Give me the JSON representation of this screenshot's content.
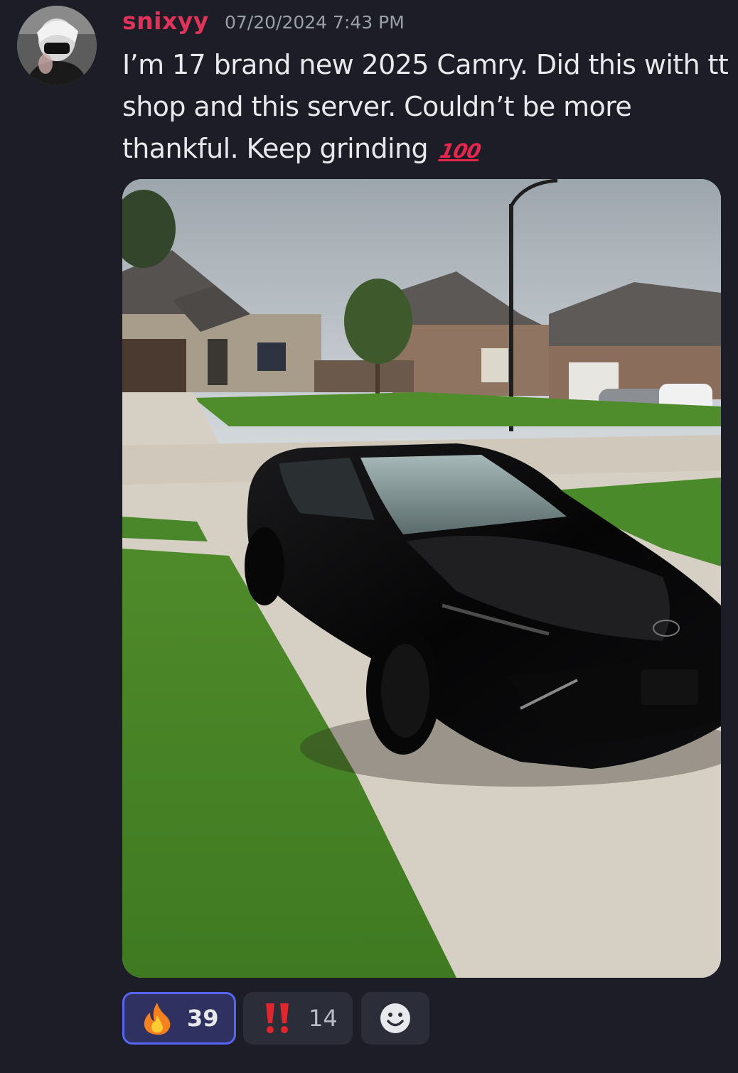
{
  "message": {
    "author": "snixyy",
    "timestamp": "07/20/2024 7:43 PM",
    "text": "I’m 17 brand new 2025 Camry. Did this with tt shop and this server. Couldn’t be more thankful. Keep grinding",
    "trailing_emoji_glyph": "100",
    "trailing_emoji_name": "hundred-points-icon",
    "author_color": "#e0335a"
  },
  "attachment": {
    "description": "photo of a black 2025 Toyota Camry parked on a driveway in front of houses"
  },
  "reactions": [
    {
      "emoji_name": "fire-icon",
      "count": "39",
      "selected": true
    },
    {
      "emoji_name": "double-exclamation-icon",
      "count": "14",
      "selected": false
    }
  ],
  "add_reaction_icon": "smiley-add-reaction-icon",
  "colors": {
    "background": "#1c1d26",
    "accent": "#5865f2"
  }
}
